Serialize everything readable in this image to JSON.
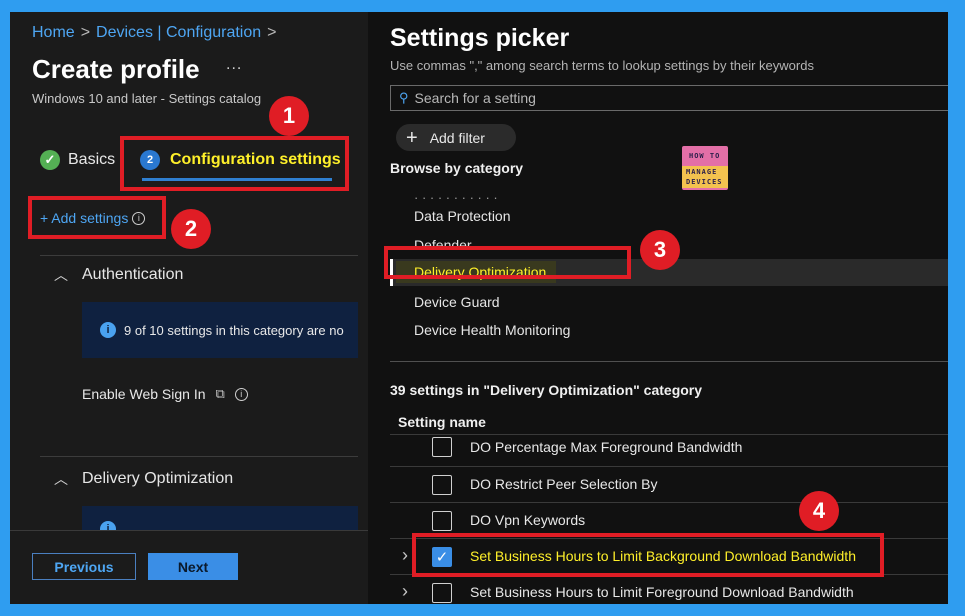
{
  "left_panel": {
    "breadcrumb": [
      "Home",
      "Devices | Configuration"
    ],
    "title": "Create profile",
    "more": "...",
    "subtitle": "Windows 10 and later - Settings catalog",
    "tabs": [
      {
        "step": "✓",
        "label": "Basics",
        "state": "done"
      },
      {
        "step": "2",
        "label": "Configuration settings",
        "state": "active"
      }
    ],
    "add_settings": "+ Add settings",
    "sections": [
      {
        "title": "Authentication",
        "info": "9 of 10 settings in this category are no",
        "setting": "Enable Web Sign In"
      },
      {
        "title": "Delivery Optimization"
      }
    ],
    "buttons": {
      "previous": "Previous",
      "next": "Next"
    }
  },
  "settings_picker": {
    "title": "Settings picker",
    "subtitle": "Use commas \",\" among search terms to lookup settings by their keywords",
    "search_placeholder": "Search for a setting",
    "add_filter": "Add filter",
    "browse_label": "Browse by category",
    "categories": [
      "Data Protection",
      "Defender",
      "Delivery Optimization",
      "Device Guard",
      "Device Health Monitoring"
    ],
    "selected_category": "Delivery Optimization",
    "count_text": "39 settings in \"Delivery Optimization\" category",
    "column_header": "Setting name",
    "settings": [
      {
        "name": "DO Percentage Max Foreground Bandwidth",
        "checked": false,
        "expandable": false
      },
      {
        "name": "DO Restrict Peer Selection By",
        "checked": false,
        "expandable": false
      },
      {
        "name": "DO Vpn Keywords",
        "checked": false,
        "expandable": false
      },
      {
        "name": "Set Business Hours to Limit Background Download Bandwidth",
        "checked": true,
        "expandable": true
      },
      {
        "name": "Set Business Hours to Limit Foreground Download Bandwidth",
        "checked": false,
        "expandable": true
      }
    ]
  },
  "logo": {
    "line1": "HOW TO",
    "line2": "MANAGE",
    "line3": "DEVICES"
  },
  "annotations": [
    "1",
    "2",
    "3",
    "4"
  ],
  "colors": {
    "frame_border": "#2f9df0",
    "accent_blue": "#3a8ee6",
    "highlight_yellow": "#fff02a",
    "annotation_red": "#e01d25"
  }
}
